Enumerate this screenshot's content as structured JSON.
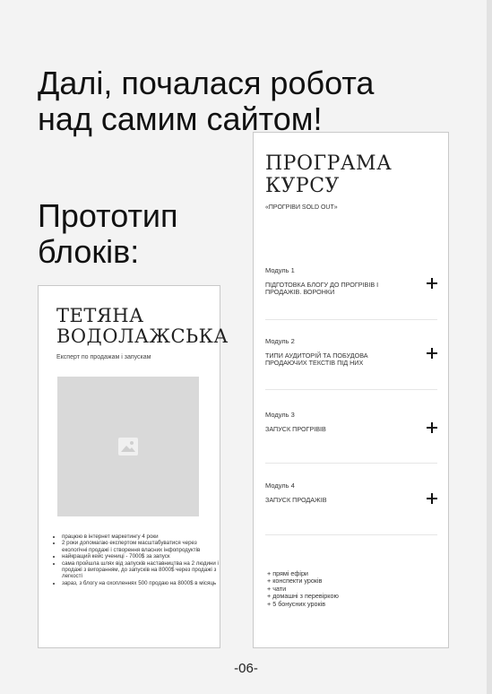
{
  "headings": {
    "intro": "Далі, почалася робота\nнад самим сайтом!",
    "prototype": "Прототип\nблоків:"
  },
  "hero_block": {
    "name": "ТЕТЯНА\nВОДОЛАЖСЬКА",
    "subtitle": "Експерт по продажам і запускам",
    "image_placeholder_icon": "image-icon",
    "bullets": [
      "працюю в інтернет маркетингу 4 роки",
      "2 роки допомагаю експертом масштабуватися через екологічні продажі і створення власних інфопродуктів",
      "найкращий кейс учениці - 7000$ за запуск",
      "сама пройшла шлях від запусків наставництва на 2 людини і продажі з вигоранням, до запусків на 8000$ через продажі з легкості",
      "зараз, з блогу на охопленнях 500 продаю на 8000$ в місяць"
    ]
  },
  "program_block": {
    "title": "ПРОГРАМА\nКУРСУ",
    "subtitle": "«ПРОГРІВИ SOLD OUT»",
    "modules": [
      {
        "label": "Модуль 1",
        "title": "ПІДГОТОВКА БЛОГУ ДО ПРОГРІВІВ І\nПРОДАЖІВ. ВОРОНКИ"
      },
      {
        "label": "Модуль 2",
        "title": "ТИПИ АУДИТОРІЙ ТА ПОБУДОВА\nПРОДАЮЧИХ ТЕКСТІВ ПІД НИХ"
      },
      {
        "label": "Модуль 3",
        "title": "ЗАПУСК ПРОГРІВІВ"
      },
      {
        "label": "Модуль 4",
        "title": "ЗАПУСК ПРОДАЖІВ"
      }
    ],
    "features": [
      "+ прямі ефіри",
      "+ конспекти уроків",
      "+ чати",
      "+ домашні з перевіркою",
      "+ 5 бонусних уроків"
    ]
  },
  "footer": {
    "page_number": "-06-"
  }
}
